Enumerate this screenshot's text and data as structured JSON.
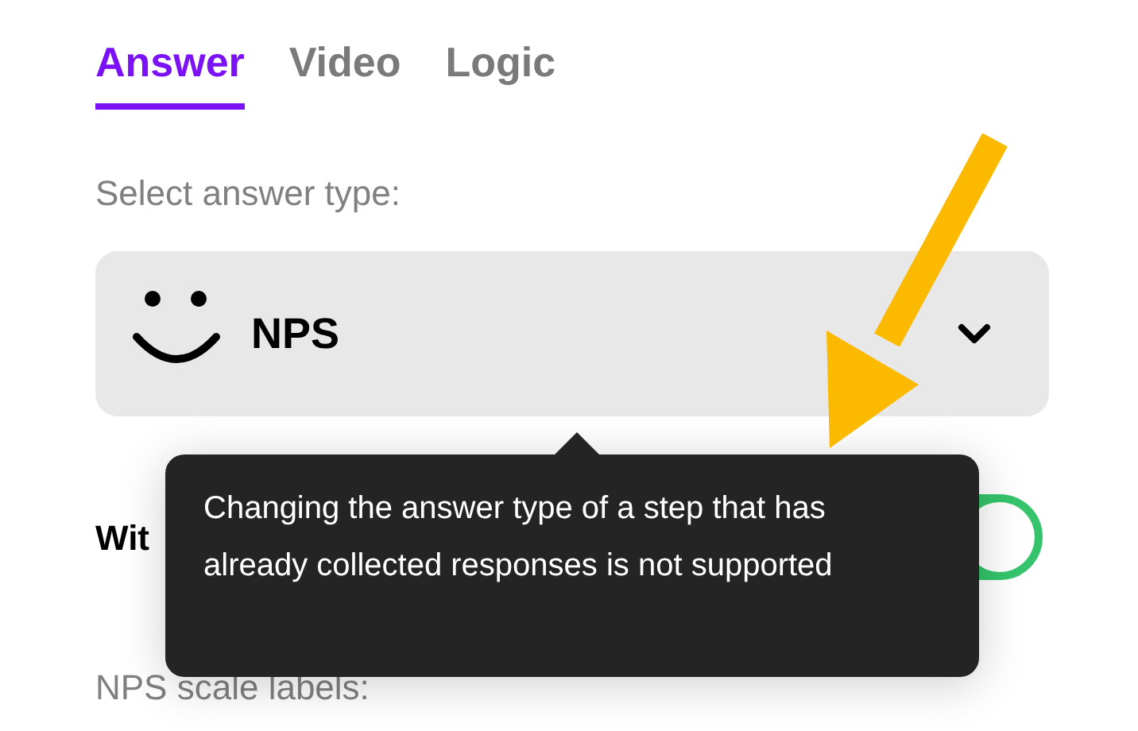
{
  "tabs": [
    {
      "label": "Answer",
      "selected": true
    },
    {
      "label": "Video",
      "selected": false
    },
    {
      "label": "Logic",
      "selected": false
    }
  ],
  "answer_type": {
    "label": "Select answer type:",
    "value": "NPS"
  },
  "toggle_row": {
    "label": "Wit",
    "on": true
  },
  "scale_labels": {
    "label": "NPS scale labels:"
  },
  "tooltip": {
    "text": "Changing the answer type of a step that has already collected responses is not supported"
  }
}
